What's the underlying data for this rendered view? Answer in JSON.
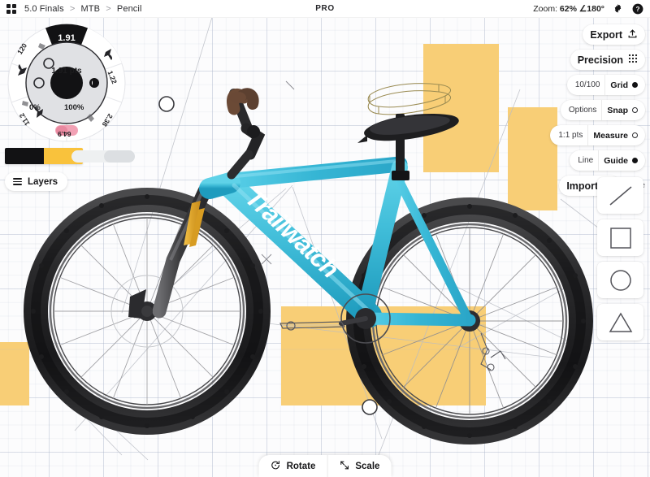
{
  "header": {
    "apps_icon": "grid-apps-icon",
    "breadcrumb": [
      "5.0 Finals",
      "MTB",
      "Pencil"
    ],
    "separator": ">",
    "title": "PRO",
    "zoom_prefix": "Zoom:",
    "zoom_value": "62%",
    "angle_value": "∠180°",
    "settings_icon": "gear-icon",
    "help_icon": "help-icon"
  },
  "right_panel": {
    "export_label": "Export",
    "export_icon": "upload-icon",
    "precision_label": "Precision",
    "precision_icon": "grid-dots-icon",
    "settings_rows": [
      {
        "value": "10/100",
        "label": "Grid",
        "state": "on"
      },
      {
        "value": "Options",
        "label": "Snap",
        "state": "off"
      },
      {
        "value": "1:1 pts",
        "label": "Measure",
        "state": "off"
      },
      {
        "value": "Line",
        "label": "Guide",
        "state": "on"
      }
    ],
    "import_label": "Import",
    "import_icon": "download-icon",
    "more_label": "More",
    "shape_tools": [
      {
        "name": "line-tool",
        "icon": "diagonal-line-icon"
      },
      {
        "name": "square-tool",
        "icon": "square-icon"
      },
      {
        "name": "circle-tool",
        "icon": "circle-icon"
      },
      {
        "name": "triangle-tool",
        "icon": "triangle-icon"
      }
    ]
  },
  "dial": {
    "top_value": "1.91",
    "center_value": "1.91 pts",
    "min_label": "0%",
    "max_label": "100%",
    "segments": [
      "120",
      "1.22",
      "2.38",
      "64.9",
      "11.2"
    ],
    "toggle_color": "#f2a2b5"
  },
  "tools": {
    "swatch_primary": "#121214",
    "swatch_secondary": "#f9c23c",
    "layers_label": "Layers",
    "layers_icon": "hamburger-icon"
  },
  "bottom_bar": {
    "items": [
      {
        "label": "Rotate",
        "icon": "rotate-icon"
      },
      {
        "label": "Scale",
        "icon": "scale-icon"
      }
    ]
  },
  "canvas": {
    "brand_text": "Trailwatch",
    "frame_color": "#3fbcd8",
    "highlight_color": "#f8ce76",
    "grid_color": "#a0acc3",
    "background": "#fcfcfd"
  }
}
